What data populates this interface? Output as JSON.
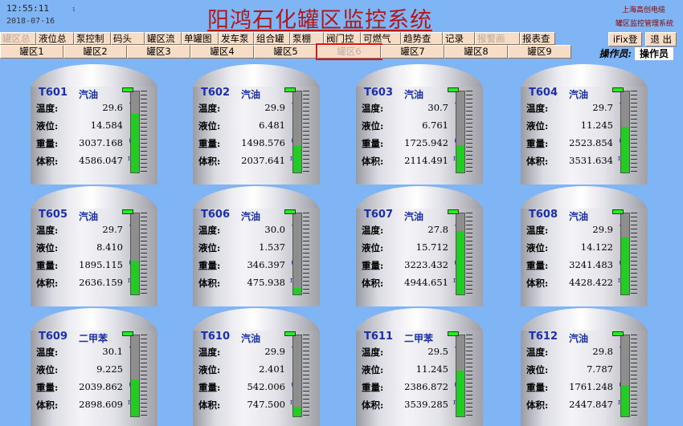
{
  "header": {
    "time": "12:55:11",
    "date": "2018-07-16",
    "marker": "1",
    "title": "阳鸿石化罐区监控系统",
    "company": "上海高创电缆",
    "system": "罐区监控管理系统"
  },
  "nav_top": [
    {
      "label": "罐区总",
      "disabled": true
    },
    {
      "label": "液位总",
      "disabled": false
    },
    {
      "label": "泵控制",
      "disabled": false
    },
    {
      "label": "码头",
      "disabled": false
    },
    {
      "label": "罐区流",
      "disabled": false
    },
    {
      "label": "单罐图",
      "disabled": false
    },
    {
      "label": "发车泵",
      "disabled": false
    },
    {
      "label": "组合罐",
      "disabled": false
    },
    {
      "label": "泵棚",
      "disabled": false
    },
    {
      "label": "阀门控",
      "disabled": false
    },
    {
      "label": "可燃气",
      "disabled": false
    },
    {
      "label": "趋势查",
      "disabled": false
    },
    {
      "label": "记录",
      "disabled": false
    },
    {
      "label": "报警画",
      "disabled": true
    },
    {
      "label": "报表查",
      "disabled": false
    }
  ],
  "right_buttons": {
    "ifix": "iFix登",
    "exit": "退 出"
  },
  "nav_areas": [
    "罐区1",
    "罐区2",
    "罐区3",
    "罐区4",
    "罐区5",
    "罐区6",
    "罐区7",
    "罐区8",
    "罐区9"
  ],
  "active_area_index": 5,
  "operator": {
    "label": "操作员:",
    "value": "操作员"
  },
  "field_labels": {
    "temp": "温度:",
    "level": "液位:",
    "weight": "重量:",
    "volume": "体积:"
  },
  "units": {
    "temp": "℃",
    "level": "m",
    "weight": "(t)",
    "volume": "m³"
  },
  "colors": {
    "background": "#7fb5f5",
    "fill": "#22cc22",
    "title": "#b01818",
    "tank_name": "#1a2fa8"
  },
  "tanks": [
    {
      "name": "T601",
      "product": "汽油",
      "temp": "29.6",
      "level": "14.584",
      "weight": "3037.168",
      "volume": "4586.047",
      "fill": 0.72
    },
    {
      "name": "T602",
      "product": "汽油",
      "temp": "29.9",
      "level": "6.481",
      "weight": "1498.576",
      "volume": "2037.641",
      "fill": 0.33
    },
    {
      "name": "T603",
      "product": "汽油",
      "temp": "30.7",
      "level": "6.761",
      "weight": "1725.942",
      "volume": "2114.491",
      "fill": 0.34
    },
    {
      "name": "T604",
      "product": "汽油",
      "temp": "29.7",
      "level": "11.245",
      "weight": "2523.854",
      "volume": "3531.634",
      "fill": 0.56
    },
    {
      "name": "T605",
      "product": "汽油",
      "temp": "29.7",
      "level": "8.410",
      "weight": "1895.115",
      "volume": "2636.159",
      "fill": 0.42
    },
    {
      "name": "T606",
      "product": "汽油",
      "temp": "30.0",
      "level": "1.537",
      "weight": "346.397",
      "volume": "475.938",
      "fill": 0.08
    },
    {
      "name": "T607",
      "product": "汽油",
      "temp": "27.8",
      "level": "15.712",
      "weight": "3223.432",
      "volume": "4944.651",
      "fill": 0.78
    },
    {
      "name": "T608",
      "product": "汽油",
      "temp": "29.9",
      "level": "14.122",
      "weight": "3241.483",
      "volume": "4428.422",
      "fill": 0.7
    },
    {
      "name": "T609",
      "product": "二甲苯",
      "temp": "30.1",
      "level": "9.225",
      "weight": "2039.862",
      "volume": "2898.609",
      "fill": 0.46
    },
    {
      "name": "T610",
      "product": "汽油",
      "temp": "29.9",
      "level": "2.401",
      "weight": "542.006",
      "volume": "747.500",
      "fill": 0.12
    },
    {
      "name": "T611",
      "product": "二甲苯",
      "temp": "29.5",
      "level": "11.245",
      "weight": "2386.872",
      "volume": "3539.285",
      "fill": 0.56
    },
    {
      "name": "T612",
      "product": "汽油",
      "temp": "29.8",
      "level": "7.787",
      "weight": "1761.248",
      "volume": "2447.847",
      "fill": 0.39
    }
  ]
}
